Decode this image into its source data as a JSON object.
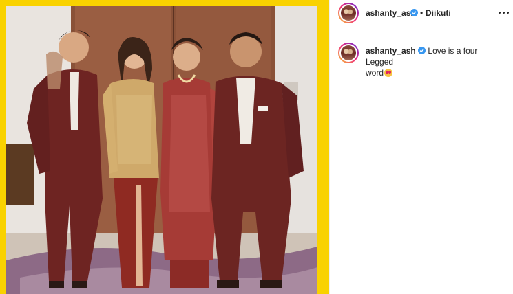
{
  "post": {
    "username": "ashanty_ash",
    "separator": "•",
    "follow_status": "Diikuti",
    "caption": {
      "username": "ashanty_ash",
      "text_line1": "Love is a four Legged",
      "text_line2": "word",
      "emoji": "star-struck-emoji"
    }
  },
  "icons": {
    "verified": "verified-badge-icon",
    "more": "more-options-icon"
  },
  "colors": {
    "frame_yellow": "#f9d200",
    "verified_blue": "#3897f0",
    "text": "#262626"
  }
}
